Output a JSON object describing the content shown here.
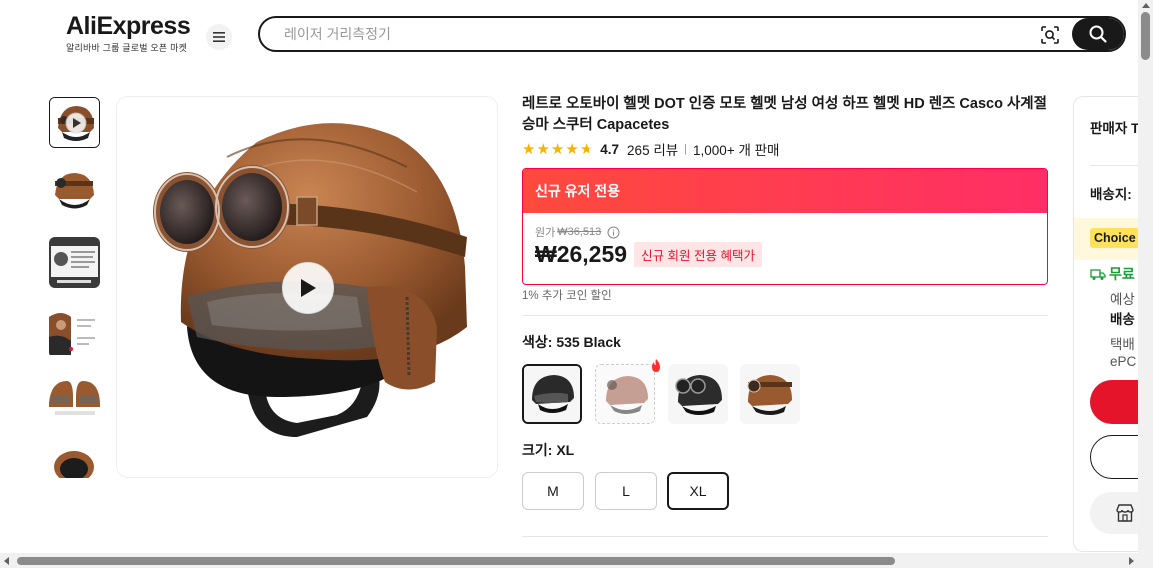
{
  "header": {
    "logo_text": "AliExpress",
    "logo_sub": "알리바바 그룹 글로벌 오픈 마켓",
    "search_placeholder": "레이저 거리측정기",
    "icons": [
      "menu-icon",
      "camera-search-icon",
      "search-icon"
    ]
  },
  "gallery": {
    "thumbnails": [
      "video-thumbnail",
      "helmet-side",
      "description-sheet",
      "detail-strap",
      "helmet-front-back",
      "helmet-inner"
    ],
    "active_index": 0
  },
  "product": {
    "title": "레트로 오토바이 헬멧 DOT 인증 모토 헬멧 남성 여성 하프 헬멧 HD 렌즈 Casco 사계절 승마 스쿠터 Capacetes",
    "rating": "4.7",
    "stars": 4.7,
    "reviews": "265 리뷰",
    "sold": "1,000+ 개 판매"
  },
  "promo": {
    "header": "신규 유저 전용",
    "original_label": "원가",
    "original_price": "₩36,513",
    "price": "₩26,259",
    "badge": "신규 회원 전용 혜택가",
    "coin_text": "1% 추가 코인 할인"
  },
  "color_option": {
    "label": "색상: ",
    "selected": "535 Black",
    "swatches": [
      "black-helmet",
      "brown-helmet-hot",
      "black-goggle-helmet",
      "brown-goggle-helmet"
    ]
  },
  "size_option": {
    "label": "크기: ",
    "selected": "XL",
    "sizes": [
      "M",
      "L",
      "XL"
    ]
  },
  "side_panel": {
    "seller_label": "판매자",
    "seller_trunc": "T",
    "ship_label": "배송지:",
    "choice_label": "Choice",
    "free_label": "무료",
    "line1": "예상",
    "line2": "배송",
    "line3": "택배",
    "line4": "ePC"
  },
  "colors": {
    "accent_red": "#e5142b",
    "promo_start": "#ff4a3c",
    "promo_end": "#ff2e66",
    "star": "#f5b400"
  }
}
